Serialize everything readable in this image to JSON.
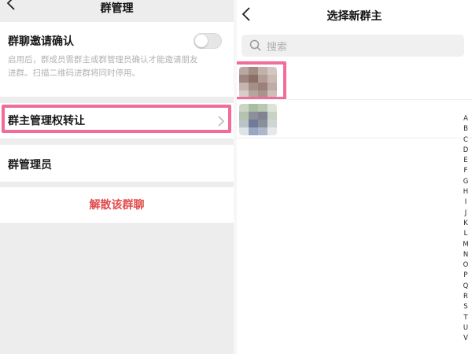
{
  "left": {
    "title": "群管理",
    "invite_confirm": {
      "title": "群聊邀请确认",
      "enabled": false,
      "desc_line1": "启用后，群成员需群主或群管理员确认才能邀请朋友",
      "desc_line2": "进群。扫描二维码进群将同时停用。"
    },
    "transfer_owner": {
      "label": "群主管理权转让"
    },
    "admins": {
      "label": "群管理员"
    },
    "disband": {
      "label": "解散该群聊",
      "color": "#e24b4b"
    },
    "highlight_color": "#f06c9b"
  },
  "right": {
    "title": "选择新群主",
    "search": {
      "placeholder": "搜索"
    },
    "index_letters": [
      "A",
      "B",
      "C",
      "D",
      "E",
      "F",
      "G",
      "H",
      "I",
      "J",
      "K",
      "L",
      "M",
      "N",
      "O",
      "P",
      "Q",
      "R",
      "S",
      "T",
      "U",
      "V"
    ]
  },
  "colors": {
    "page_bg": "#ededed",
    "card_bg": "#ffffff",
    "desc": "#b3b3b3"
  }
}
